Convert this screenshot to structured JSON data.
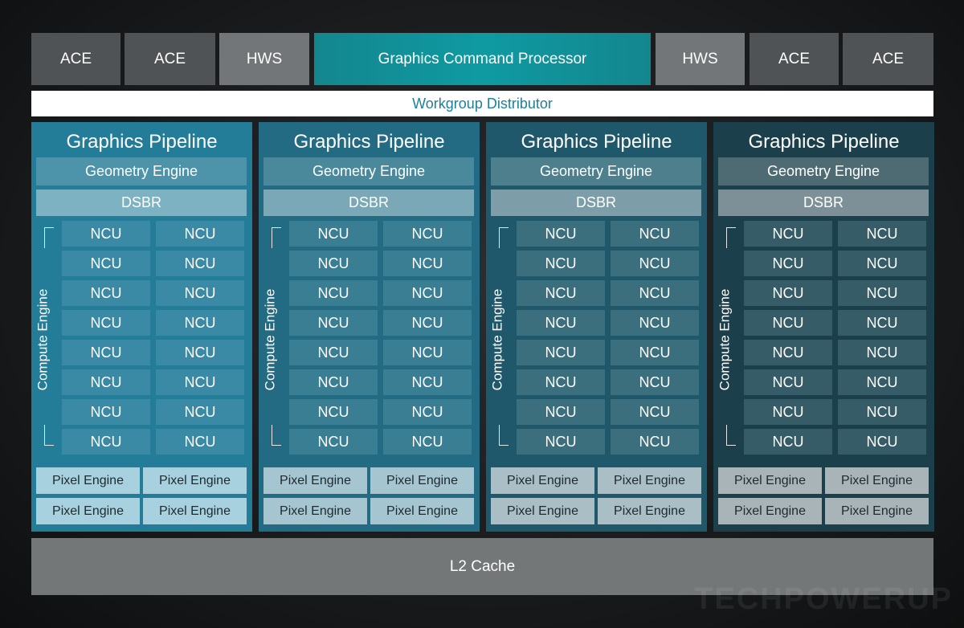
{
  "top_row": {
    "left_blocks": [
      {
        "label": "ACE",
        "kind": "ace"
      },
      {
        "label": "ACE",
        "kind": "ace"
      },
      {
        "label": "HWS",
        "kind": "hws"
      }
    ],
    "command_processor": "Graphics Command Processor",
    "right_blocks": [
      {
        "label": "HWS",
        "kind": "hws"
      },
      {
        "label": "ACE",
        "kind": "ace"
      },
      {
        "label": "ACE",
        "kind": "ace"
      }
    ]
  },
  "workgroup_distributor": "Workgroup Distributor",
  "pipelines": [
    {
      "title": "Graphics Pipeline",
      "geometry_engine": "Geometry Engine",
      "dsbr": "DSBR",
      "compute_engine_label": "Compute Engine",
      "ncu_rows": [
        [
          "NCU",
          "NCU"
        ],
        [
          "NCU",
          "NCU"
        ],
        [
          "NCU",
          "NCU"
        ],
        [
          "NCU",
          "NCU"
        ],
        [
          "NCU",
          "NCU"
        ],
        [
          "NCU",
          "NCU"
        ],
        [
          "NCU",
          "NCU"
        ],
        [
          "NCU",
          "NCU"
        ]
      ],
      "pixel_engines": [
        "Pixel Engine",
        "Pixel Engine",
        "Pixel Engine",
        "Pixel Engine"
      ],
      "colors": {
        "panel": "#237c98",
        "geo": "#4d94aa",
        "dsbr": "#7db2c3",
        "ncu": "#3b8aa5",
        "pixel": "#a7d1de"
      }
    },
    {
      "title": "Graphics Pipeline",
      "geometry_engine": "Geometry Engine",
      "dsbr": "DSBR",
      "compute_engine_label": "Compute Engine",
      "ncu_rows": [
        [
          "NCU",
          "NCU"
        ],
        [
          "NCU",
          "NCU"
        ],
        [
          "NCU",
          "NCU"
        ],
        [
          "NCU",
          "NCU"
        ],
        [
          "NCU",
          "NCU"
        ],
        [
          "NCU",
          "NCU"
        ],
        [
          "NCU",
          "NCU"
        ],
        [
          "NCU",
          "NCU"
        ]
      ],
      "pixel_engines": [
        "Pixel Engine",
        "Pixel Engine",
        "Pixel Engine",
        "Pixel Engine"
      ],
      "colors": {
        "panel": "#226b83",
        "geo": "#4a899c",
        "dsbr": "#7aa8b6",
        "ncu": "#3a7e94",
        "pixel": "#a5c6d0"
      }
    },
    {
      "title": "Graphics Pipeline",
      "geometry_engine": "Geometry Engine",
      "dsbr": "DSBR",
      "compute_engine_label": "Compute Engine",
      "ncu_rows": [
        [
          "NCU",
          "NCU"
        ],
        [
          "NCU",
          "NCU"
        ],
        [
          "NCU",
          "NCU"
        ],
        [
          "NCU",
          "NCU"
        ],
        [
          "NCU",
          "NCU"
        ],
        [
          "NCU",
          "NCU"
        ],
        [
          "NCU",
          "NCU"
        ],
        [
          "NCU",
          "NCU"
        ]
      ],
      "pixel_engines": [
        "Pixel Engine",
        "Pixel Engine",
        "Pixel Engine",
        "Pixel Engine"
      ],
      "colors": {
        "panel": "#1f586a",
        "geo": "#4e7f8d",
        "dsbr": "#7d9ea8",
        "ncu": "#3b6f7e",
        "pixel": "#a9bfc5"
      }
    },
    {
      "title": "Graphics Pipeline",
      "geometry_engine": "Geometry Engine",
      "dsbr": "DSBR",
      "compute_engine_label": "Compute Engine",
      "ncu_rows": [
        [
          "NCU",
          "NCU"
        ],
        [
          "NCU",
          "NCU"
        ],
        [
          "NCU",
          "NCU"
        ],
        [
          "NCU",
          "NCU"
        ],
        [
          "NCU",
          "NCU"
        ],
        [
          "NCU",
          "NCU"
        ],
        [
          "NCU",
          "NCU"
        ],
        [
          "NCU",
          "NCU"
        ]
      ],
      "pixel_engines": [
        "Pixel Engine",
        "Pixel Engine",
        "Pixel Engine",
        "Pixel Engine"
      ],
      "colors": {
        "panel": "#1b3f4b",
        "geo": "#4e6b74",
        "dsbr": "#7d9097",
        "ncu": "#365c67",
        "pixel": "#a8b4b8"
      }
    }
  ],
  "l2_cache": "L2 Cache",
  "watermark": "TECHPOWERUP"
}
